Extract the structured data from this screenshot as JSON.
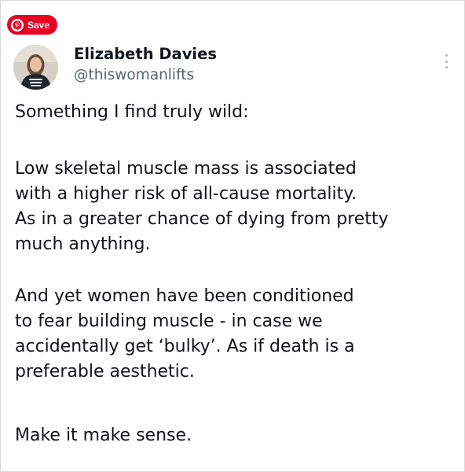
{
  "pin_button": {
    "label": "Save"
  },
  "author": {
    "name": "Elizabeth Davies",
    "handle": "@thiswomanlifts"
  },
  "tweet": {
    "paragraph1": [
      "Something I find truly wild:"
    ],
    "paragraph2": [
      "Low skeletal muscle mass is associated",
      "with a higher risk of all-cause mortality.",
      "As in a greater chance of dying from pretty",
      "much anything."
    ],
    "paragraph3": [
      "And yet women have been conditioned",
      "to fear building muscle - in case we",
      "accidentally get ‘bulky’. As if death is a",
      "preferable aesthetic."
    ],
    "paragraph4": [
      "Make it make sense."
    ]
  },
  "colors": {
    "pinterest_red": "#e60023",
    "text": "#0f1419",
    "handle": "#536471"
  }
}
